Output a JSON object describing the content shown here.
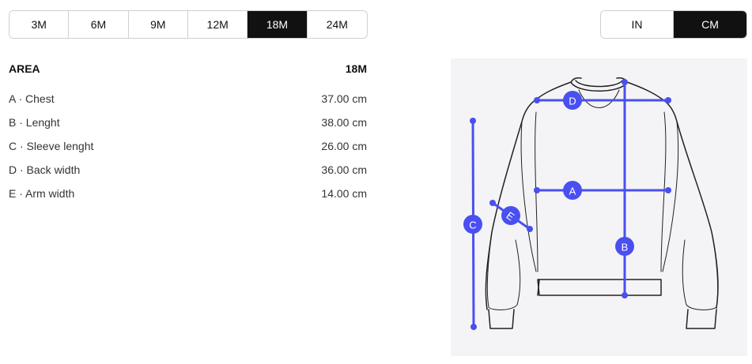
{
  "size_selector": {
    "options": [
      "3M",
      "6M",
      "9M",
      "12M",
      "18M",
      "24M"
    ],
    "selected": "18M"
  },
  "unit_selector": {
    "options": [
      "IN",
      "CM"
    ],
    "selected": "CM"
  },
  "table": {
    "header_area": "AREA",
    "header_size": "18M",
    "rows": [
      {
        "label": "A · Chest",
        "value": "37.00 cm"
      },
      {
        "label": "B · Lenght",
        "value": "38.00 cm"
      },
      {
        "label": "C · Sleeve lenght",
        "value": "26.00 cm"
      },
      {
        "label": "D · Back width",
        "value": "36.00 cm"
      },
      {
        "label": "E · Arm width",
        "value": "14.00 cm"
      }
    ]
  },
  "diagram": {
    "markers": {
      "a": "A",
      "b": "B",
      "c": "C",
      "d": "D",
      "e": "E"
    },
    "measure_color": "#4a4ff0",
    "background": "#f4f4f6"
  }
}
